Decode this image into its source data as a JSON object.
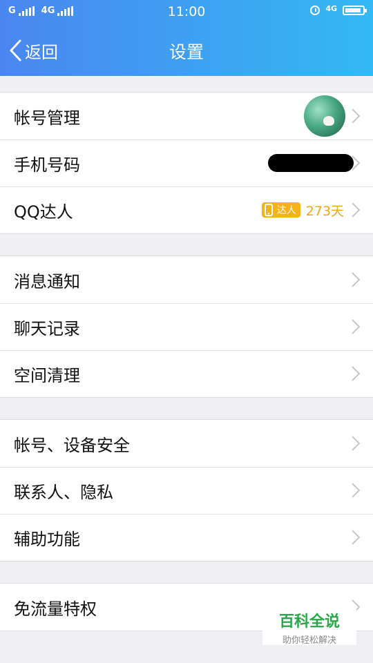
{
  "status": {
    "carrier1": "G",
    "carrier2": "4G",
    "time": "11:00",
    "right_net": "4G"
  },
  "nav": {
    "back_label": "返回",
    "title": "设置"
  },
  "groups": [
    {
      "rows": [
        {
          "label": "帐号管理",
          "right": "avatar"
        },
        {
          "label": "手机号码",
          "right": "redacted"
        },
        {
          "label": "QQ达人",
          "right": "badge",
          "badge_text": "达人",
          "days": "273天"
        }
      ]
    },
    {
      "rows": [
        {
          "label": "消息通知"
        },
        {
          "label": "聊天记录"
        },
        {
          "label": "空间清理"
        }
      ]
    },
    {
      "rows": [
        {
          "label": "帐号、设备安全"
        },
        {
          "label": "联系人、隐私"
        },
        {
          "label": "辅助功能"
        }
      ]
    },
    {
      "rows": [
        {
          "label": "免流量特权"
        }
      ]
    }
  ],
  "watermark": {
    "title": "百科全说",
    "subtitle": "助你轻松解决"
  },
  "colors": {
    "header_left": "#4a86f0",
    "header_right": "#33b9f3",
    "badge": "#f6b21b",
    "days": "#f3a416"
  }
}
